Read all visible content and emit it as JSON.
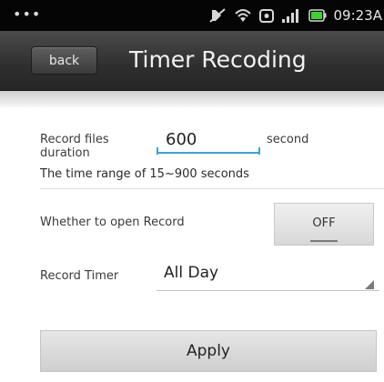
{
  "status_bar": {
    "dots": "•••",
    "time": "09:23A",
    "icons": [
      "mute-icon",
      "wifi-icon",
      "alarm-icon",
      "signal-icon",
      "battery-icon"
    ],
    "battery_color": "#3fcf2f"
  },
  "header": {
    "back_label": "back",
    "title": "Timer Recoding"
  },
  "form": {
    "duration_label": "Record files duration",
    "duration_value": "600",
    "duration_unit": "second",
    "range_hint": "The time range of 15~900 seconds",
    "open_label": "Whether to open Record",
    "open_toggle": "OFF",
    "timer_label": "Record Timer",
    "timer_value": "All Day"
  },
  "actions": {
    "apply_label": "Apply"
  },
  "colors": {
    "accent": "#3aa3d8",
    "header_bg": "#333333"
  }
}
